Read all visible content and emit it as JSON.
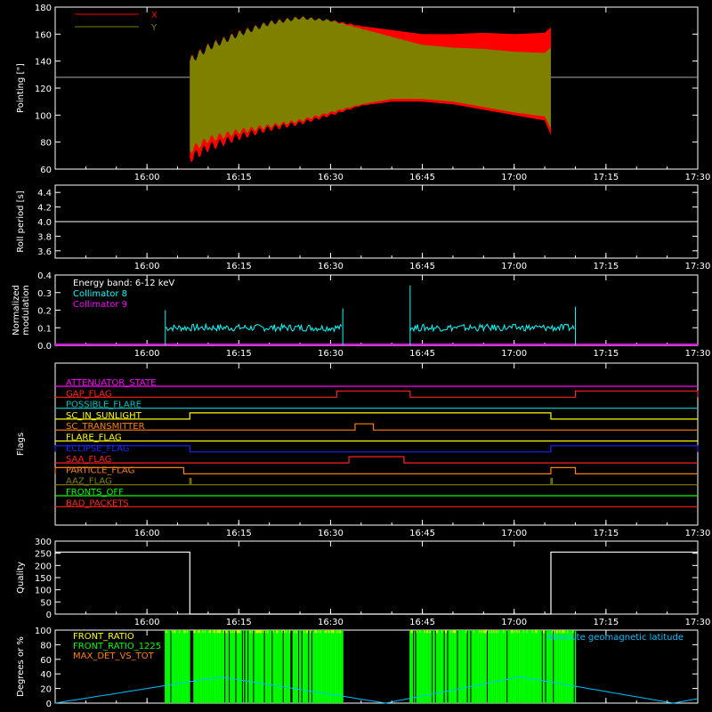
{
  "time_axis": {
    "range": [
      "15:45",
      "17:30"
    ],
    "ticks": [
      "16:00",
      "16:15",
      "16:30",
      "16:45",
      "17:00",
      "17:15",
      "17:30"
    ]
  },
  "chart_data": [
    {
      "type": "area",
      "ylabel": "Pointing [\"]",
      "ylim": [
        60,
        180
      ],
      "yticks": [
        "60",
        "80",
        "100",
        "120",
        "140",
        "160",
        "180"
      ],
      "legend_position": "top-left",
      "baseline": 128,
      "data_range": [
        "16:07",
        "17:06"
      ],
      "series": [
        {
          "name": "X",
          "color": "#ff0000",
          "x": [
            "16:07",
            "16:10",
            "16:15",
            "16:20",
            "16:25",
            "16:30",
            "16:35",
            "16:40",
            "16:45",
            "16:50",
            "16:55",
            "17:00",
            "17:05",
            "17:06"
          ],
          "upper": [
            140,
            150,
            160,
            168,
            172,
            170,
            166,
            163,
            160,
            160,
            161,
            160,
            161,
            165
          ],
          "lower": [
            68,
            76,
            84,
            90,
            94,
            100,
            107,
            110,
            110,
            108,
            104,
            100,
            96,
            85
          ]
        },
        {
          "name": "Y",
          "color": "#808000",
          "x": [
            "16:07",
            "16:10",
            "16:15",
            "16:20",
            "16:25",
            "16:30",
            "16:35",
            "16:40",
            "16:45",
            "16:50",
            "16:55",
            "17:00",
            "17:05",
            "17:06"
          ],
          "upper": [
            140,
            150,
            160,
            168,
            172,
            170,
            164,
            158,
            152,
            150,
            149,
            147,
            146,
            150
          ],
          "lower": [
            74,
            82,
            88,
            92,
            96,
            102,
            108,
            112,
            112,
            110,
            106,
            102,
            99,
            90
          ]
        }
      ]
    },
    {
      "type": "line",
      "ylabel": "Roll period [s]",
      "ylim": [
        3.5,
        4.5
      ],
      "yticks": [
        "3.6",
        "3.8",
        "4.0",
        "4.2",
        "4.4"
      ],
      "series": [
        {
          "color": "#ffffff",
          "x": [
            "15:45",
            "17:30"
          ],
          "y": [
            4.0,
            4.0
          ]
        }
      ]
    },
    {
      "type": "line",
      "ylabel": "Normalized modulation",
      "ylim": [
        0,
        0.4
      ],
      "yticks": [
        "0.0",
        "0.1",
        "0.2",
        "0.3",
        "0.4"
      ],
      "annotation": "Energy band: 6-12 keV",
      "legend_position": "top-left",
      "series": [
        {
          "name": "Collimator 8",
          "color": "#00ffff",
          "segments": [
            [
              "16:03",
              "16:32"
            ],
            [
              "16:43",
              "17:10"
            ]
          ],
          "level": 0.1,
          "spikes": [
            [
              "16:03",
              0.2
            ],
            [
              "16:32",
              0.21
            ],
            [
              "16:43",
              0.34
            ],
            [
              "17:10",
              0.22
            ]
          ]
        },
        {
          "name": "Collimator 9",
          "color": "#ff00ff",
          "x": [
            "15:45",
            "17:30"
          ],
          "y": [
            0,
            0
          ]
        }
      ]
    },
    {
      "type": "line",
      "ylabel": "Flags",
      "flags": [
        {
          "name": "ATTENUATOR_STATE",
          "color": "#ff00ff",
          "on": []
        },
        {
          "name": "GAP_FLAG",
          "color": "#ff2020",
          "on": [
            [
              "16:31",
              "16:43"
            ],
            [
              "17:10",
              "17:30"
            ]
          ]
        },
        {
          "name": "POSSIBLE_FLARE",
          "color": "#00c0c0",
          "on": []
        },
        {
          "name": "SC_IN_SUNLIGHT",
          "color": "#ffff00",
          "on": [
            [
              "16:07",
              "17:06"
            ]
          ]
        },
        {
          "name": "SC_TRANSMITTER",
          "color": "#ff8000",
          "on": [
            [
              "16:34",
              "16:37"
            ]
          ]
        },
        {
          "name": "FLARE_FLAG",
          "color": "#ffff00",
          "on": []
        },
        {
          "name": "ECLIPSE_FLAG",
          "color": "#2020ff",
          "on": [
            [
              "15:45",
              "16:07"
            ],
            [
              "17:06",
              "17:30"
            ]
          ]
        },
        {
          "name": "SAA_FLAG",
          "color": "#ff2020",
          "on": [
            [
              "16:33",
              "16:42"
            ]
          ]
        },
        {
          "name": "PARTICLE_FLAG",
          "color": "#ff8000",
          "on": [
            [
              "15:45",
              "16:06"
            ],
            [
              "17:06",
              "17:10"
            ]
          ]
        },
        {
          "name": "AAZ_FLAG",
          "color": "#808000",
          "on": [
            [
              "16:07",
              "16:07"
            ],
            [
              "17:06",
              "17:06"
            ]
          ]
        },
        {
          "name": "FRONTS_OFF",
          "color": "#00ff00",
          "on": []
        },
        {
          "name": "BAD_PACKETS",
          "color": "#ff2020",
          "on": []
        }
      ]
    },
    {
      "type": "line",
      "ylabel": "Quality",
      "ylim": [
        0,
        300
      ],
      "yticks": [
        "0",
        "50",
        "100",
        "150",
        "200",
        "250",
        "300"
      ],
      "series": [
        {
          "color": "#ffffff",
          "x": [
            "15:45",
            "16:07",
            "16:07",
            "17:06",
            "17:06",
            "17:30"
          ],
          "y": [
            255,
            255,
            0,
            0,
            255,
            255
          ]
        }
      ]
    },
    {
      "type": "line",
      "ylabel": "Degrees or %",
      "ylim": [
        0,
        100
      ],
      "yticks": [
        "0",
        "20",
        "40",
        "60",
        "80",
        "100"
      ],
      "legend_position": "top-left",
      "side_legend": "Absolute geomagnetic latitude",
      "series": [
        {
          "name": "FRONT_RATIO",
          "color": "#ffff00",
          "segments": [
            [
              "16:03",
              "16:32"
            ],
            [
              "16:43",
              "17:10"
            ]
          ]
        },
        {
          "name": "FRONT_RATIO_1225",
          "color": "#00ff00",
          "segments": [
            [
              "16:03",
              "16:32"
            ],
            [
              "16:43",
              "17:10"
            ]
          ]
        },
        {
          "name": "MAX_DET_VS_TOT",
          "color": "#ff8000",
          "segments": []
        },
        {
          "name": "Absolute geomagnetic latitude",
          "color": "#00c0ff",
          "x": [
            "15:45",
            "16:12",
            "16:39",
            "17:01",
            "17:26",
            "17:30"
          ],
          "y": [
            0,
            36,
            0,
            36,
            0,
            6
          ]
        }
      ]
    }
  ]
}
